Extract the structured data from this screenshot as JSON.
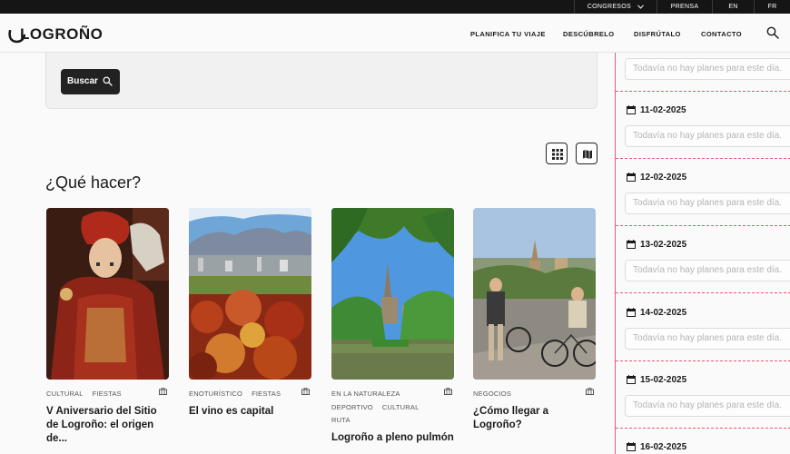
{
  "topbar": {
    "items": [
      {
        "label": "CONGRESOS"
      },
      {
        "label": "PRENSA"
      },
      {
        "label": "EN"
      },
      {
        "label": "FR"
      }
    ]
  },
  "header": {
    "logo": "LOGROÑO",
    "nav": [
      "PLANIFICA TU VIAJE",
      "DESCÚBRELO",
      "DISFRÚTALO",
      "CONTACTO"
    ]
  },
  "filters": {
    "search_button": "Buscar"
  },
  "section": {
    "title": "¿Qué hacer?"
  },
  "cards": [
    {
      "tags": [
        "CULTURAL",
        "FIESTAS"
      ],
      "title": "V Aniversario del Sitio de Logroño: el origen de..."
    },
    {
      "tags": [
        "ENOTURÍSTICO",
        "FIESTAS"
      ],
      "title": "El vino es capital"
    },
    {
      "tags": [
        "EN LA NATURALEZA",
        "DEPORTIVO",
        "CULTURAL",
        "RUTA"
      ],
      "title": "Logroño a pleno pulmón"
    },
    {
      "tags": [
        "NEGOCIOS"
      ],
      "title": "¿Cómo llegar a Logroño?"
    }
  ],
  "planner": {
    "empty_text": "Todavía no hay planes para este día.",
    "days": [
      "11-02-2025",
      "12-02-2025",
      "13-02-2025",
      "14-02-2025",
      "15-02-2025",
      "16-02-2025"
    ]
  }
}
